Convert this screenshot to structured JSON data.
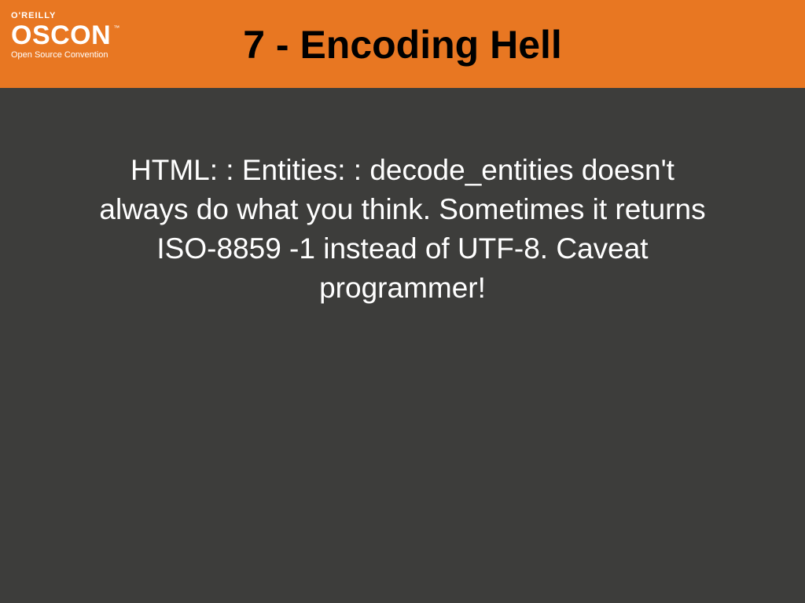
{
  "header": {
    "publisher": "O'REILLY",
    "conference": "OSCON",
    "tm": "™",
    "subtitle": "Open Source Convention",
    "title": "7 - Encoding Hell"
  },
  "content": {
    "paragraph": "HTML: : Entities: : decode_entities doesn't always do what you think. Sometimes it returns ISO-8859 -1 instead of UTF-8. Caveat programmer!"
  }
}
